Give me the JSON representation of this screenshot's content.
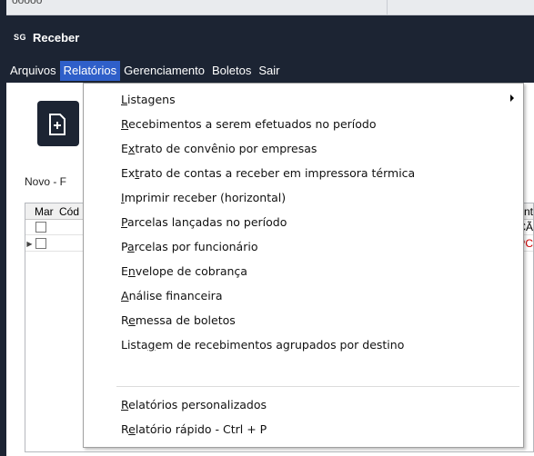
{
  "window": {
    "logo": "SG",
    "title": "Receber",
    "top_cut_text": "ooooo"
  },
  "menubar": {
    "items": [
      "Arquivos",
      "Relatórios",
      "Gerenciamento",
      "Boletos",
      "Sair"
    ]
  },
  "toolbar": {
    "new_button_icon": "new-document-icon",
    "new_label": "Novo - F"
  },
  "grid": {
    "columns": [
      "Mar",
      "Cód",
      "nt"
    ],
    "rows": [
      {
        "checked": false,
        "current": false,
        "edge_text": "CÃ",
        "edge_color": "#000000"
      },
      {
        "checked": false,
        "current": true,
        "edge_text": "PC",
        "edge_color": "#d00000"
      }
    ]
  },
  "dropdown": {
    "items": [
      {
        "pre": "",
        "mn": "L",
        "post": "istagens",
        "submenu": true
      },
      {
        "pre": "",
        "mn": "R",
        "post": "ecebimentos a serem efetuados no período"
      },
      {
        "pre": "E",
        "mn": "x",
        "post": "trato de convênio por empresas"
      },
      {
        "pre": "Ex",
        "mn": "t",
        "post": "rato de contas a receber em impressora térmica"
      },
      {
        "pre": "",
        "mn": "I",
        "post": "mprimir receber (horizontal)"
      },
      {
        "pre": "",
        "mn": "P",
        "post": "arcelas lançadas no período"
      },
      {
        "pre": "P",
        "mn": "a",
        "post": "rcelas por funcionário"
      },
      {
        "pre": "E",
        "mn": "n",
        "post": "velope de cobrança"
      },
      {
        "pre": "",
        "mn": "A",
        "post": "nálise financeira"
      },
      {
        "pre": "R",
        "mn": "e",
        "post": "messa de boletos"
      },
      {
        "pre": "Lista",
        "mn": "g",
        "post": "em de recebimentos agrupados por destino"
      },
      {
        "pre": "",
        "mn": "R",
        "post": "elatórios personalizados"
      },
      {
        "pre": "R",
        "mn": "e",
        "post": "latório rápido - Ctrl + P"
      }
    ]
  },
  "colors": {
    "chrome": "#1c2433",
    "menu_highlight": "#2f5fc9"
  }
}
